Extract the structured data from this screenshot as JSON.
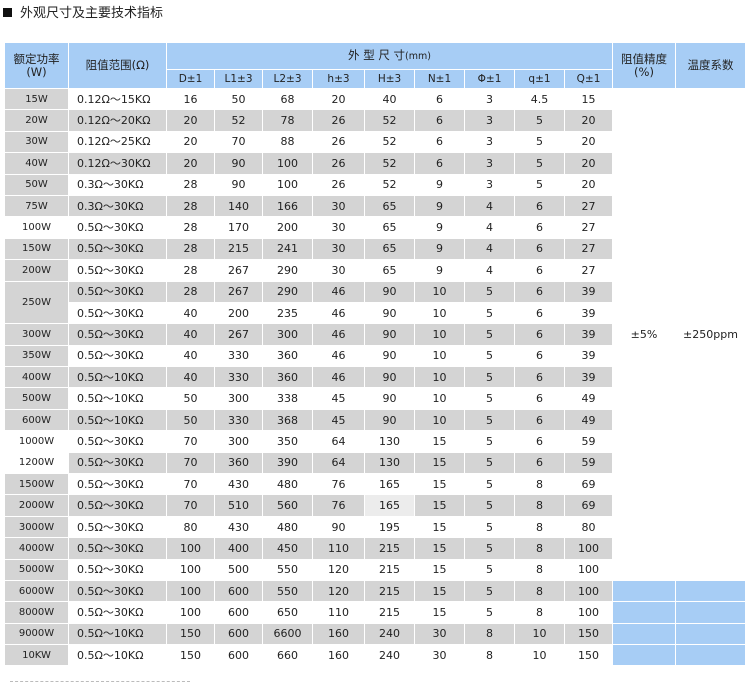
{
  "section": {
    "title": "外观尺寸及主要技术指标"
  },
  "header": {
    "rated_power": "额定功率",
    "rated_power_unit": "(W)",
    "resistance_range": "阻值范围(Ω)",
    "dimensions": "外 型 尺 寸",
    "dimensions_unit": "(mm)",
    "accuracy": "阻值精度",
    "accuracy_unit": "(%)",
    "temp_coef": "温度系数",
    "columns": [
      "D±1",
      "L1±3",
      "L2±3",
      "h±3",
      "H±3",
      "N±1",
      "Φ±1",
      "q±1",
      "Q±1"
    ]
  },
  "shared": {
    "accuracy_value": "±5%",
    "temp_coef_value": "±250ppm"
  },
  "rows": [
    {
      "power": "15W",
      "range": "0.12Ω～15KΩ",
      "dims": [
        "16",
        "50",
        "68",
        "20",
        "40",
        "6",
        "3",
        "4.5",
        "15"
      ]
    },
    {
      "power": "20W",
      "range": "0.12Ω～20KΩ",
      "dims": [
        "20",
        "52",
        "78",
        "26",
        "52",
        "6",
        "3",
        "5",
        "20"
      ]
    },
    {
      "power": "30W",
      "range": "0.12Ω～25KΩ",
      "dims": [
        "20",
        "70",
        "88",
        "26",
        "52",
        "6",
        "3",
        "5",
        "20"
      ]
    },
    {
      "power": "40W",
      "range": "0.12Ω～30KΩ",
      "dims": [
        "20",
        "90",
        "100",
        "26",
        "52",
        "6",
        "3",
        "5",
        "20"
      ]
    },
    {
      "power": "50W",
      "range": "0.3Ω～30KΩ",
      "dims": [
        "28",
        "90",
        "100",
        "26",
        "52",
        "9",
        "3",
        "5",
        "20"
      ]
    },
    {
      "power": "75W",
      "range": "0.3Ω～30KΩ",
      "dims": [
        "28",
        "140",
        "166",
        "30",
        "65",
        "9",
        "4",
        "6",
        "27"
      ]
    },
    {
      "power": "100W",
      "range": "0.5Ω～30KΩ",
      "dims": [
        "28",
        "170",
        "200",
        "30",
        "65",
        "9",
        "4",
        "6",
        "27"
      ]
    },
    {
      "power": "150W",
      "range": "0.5Ω～30KΩ",
      "dims": [
        "28",
        "215",
        "241",
        "30",
        "65",
        "9",
        "4",
        "6",
        "27"
      ]
    },
    {
      "power": "200W",
      "range": "0.5Ω～30KΩ",
      "dims": [
        "28",
        "267",
        "290",
        "30",
        "65",
        "9",
        "4",
        "6",
        "27"
      ]
    },
    {
      "power": "250W",
      "range": "0.5Ω～30KΩ",
      "dims": [
        "28",
        "267",
        "290",
        "46",
        "90",
        "10",
        "5",
        "6",
        "39"
      ]
    },
    {
      "power": "",
      "range": "0.5Ω～30KΩ",
      "dims": [
        "40",
        "200",
        "235",
        "46",
        "90",
        "10",
        "5",
        "6",
        "39"
      ]
    },
    {
      "power": "300W",
      "range": "0.5Ω～30KΩ",
      "dims": [
        "40",
        "267",
        "300",
        "46",
        "90",
        "10",
        "5",
        "6",
        "39"
      ]
    },
    {
      "power": "350W",
      "range": "0.5Ω～30KΩ",
      "dims": [
        "40",
        "330",
        "360",
        "46",
        "90",
        "10",
        "5",
        "6",
        "39"
      ]
    },
    {
      "power": "400W",
      "range": "0.5Ω～10KΩ",
      "dims": [
        "40",
        "330",
        "360",
        "46",
        "90",
        "10",
        "5",
        "6",
        "39"
      ]
    },
    {
      "power": "500W",
      "range": "0.5Ω～10KΩ",
      "dims": [
        "50",
        "300",
        "338",
        "45",
        "90",
        "10",
        "5",
        "6",
        "49"
      ]
    },
    {
      "power": "600W",
      "range": "0.5Ω～10KΩ",
      "dims": [
        "50",
        "330",
        "368",
        "45",
        "90",
        "10",
        "5",
        "6",
        "49"
      ]
    },
    {
      "power": "1000W",
      "range": "0.5Ω～30KΩ",
      "dims": [
        "70",
        "300",
        "350",
        "64",
        "130",
        "15",
        "5",
        "6",
        "59"
      ]
    },
    {
      "power": "1200W",
      "range": "0.5Ω～30KΩ",
      "dims": [
        "70",
        "360",
        "390",
        "64",
        "130",
        "15",
        "5",
        "6",
        "59"
      ]
    },
    {
      "power": "1500W",
      "range": "0.5Ω～30KΩ",
      "dims": [
        "70",
        "430",
        "480",
        "76",
        "165",
        "15",
        "5",
        "8",
        "69"
      ]
    },
    {
      "power": "2000W",
      "range": "0.5Ω～30KΩ",
      "dims": [
        "70",
        "510",
        "560",
        "76",
        "165",
        "15",
        "5",
        "8",
        "69"
      ]
    },
    {
      "power": "3000W",
      "range": "0.5Ω～30KΩ",
      "dims": [
        "80",
        "430",
        "480",
        "90",
        "195",
        "15",
        "5",
        "8",
        "80"
      ]
    },
    {
      "power": "4000W",
      "range": "0.5Ω～30KΩ",
      "dims": [
        "100",
        "400",
        "450",
        "110",
        "215",
        "15",
        "5",
        "8",
        "100"
      ]
    },
    {
      "power": "5000W",
      "range": "0.5Ω～30KΩ",
      "dims": [
        "100",
        "500",
        "550",
        "120",
        "215",
        "15",
        "5",
        "8",
        "100"
      ]
    },
    {
      "power": "6000W",
      "range": "0.5Ω～30KΩ",
      "dims": [
        "100",
        "600",
        "550",
        "120",
        "215",
        "15",
        "5",
        "8",
        "100"
      ]
    },
    {
      "power": "8000W",
      "range": "0.5Ω～30KΩ",
      "dims": [
        "100",
        "600",
        "650",
        "110",
        "215",
        "15",
        "5",
        "8",
        "100"
      ]
    },
    {
      "power": "9000W",
      "range": "0.5Ω～10KΩ",
      "dims": [
        "150",
        "600",
        "6600",
        "160",
        "240",
        "30",
        "8",
        "10",
        "150"
      ]
    },
    {
      "power": "10KW",
      "range": "0.5Ω～10KΩ",
      "dims": [
        "150",
        "600",
        "660",
        "160",
        "240",
        "30",
        "8",
        "10",
        "150"
      ]
    }
  ],
  "colors": {
    "header_blue": "#a7cdf5",
    "row_gray": "#d4d4d4",
    "row_white": "#ffffff"
  }
}
